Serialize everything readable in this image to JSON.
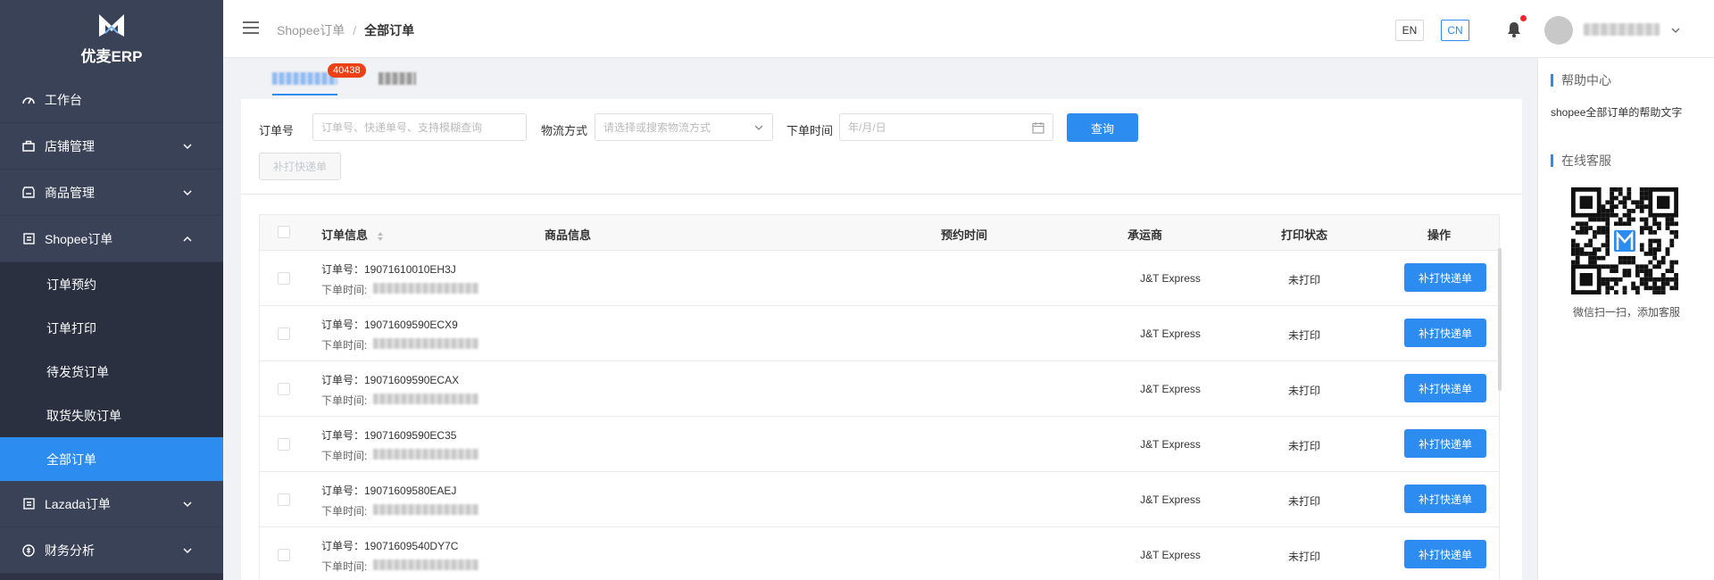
{
  "app": {
    "logo_text": "优麦ERP"
  },
  "sidebar": {
    "items": [
      {
        "label": "工作台",
        "icon": "dashboard-icon"
      },
      {
        "label": "店铺管理",
        "icon": "store-icon"
      },
      {
        "label": "商品管理",
        "icon": "goods-icon"
      },
      {
        "label": "Shopee订单",
        "icon": "order-icon"
      },
      {
        "label": "Lazada订单",
        "icon": "order-icon"
      },
      {
        "label": "财务分析",
        "icon": "finance-icon"
      }
    ],
    "shopee_sub": [
      {
        "label": "订单预约"
      },
      {
        "label": "订单打印"
      },
      {
        "label": "待发货订单"
      },
      {
        "label": "取货失败订单"
      },
      {
        "label": "全部订单"
      }
    ]
  },
  "header": {
    "breadcrumb": [
      "Shopee订单",
      "/",
      "全部订单"
    ],
    "lang_en": "EN",
    "lang_cn": "CN"
  },
  "tabs": {
    "badge": "40438"
  },
  "filter": {
    "order_label": "订单号",
    "order_placeholder": "订单号、快递单号、支持模糊查询",
    "logistics_label": "物流方式",
    "logistics_placeholder": "请选择或搜索物流方式",
    "time_label": "下单时间",
    "time_placeholder": "年/月/日",
    "query_label": "查询",
    "reprint_label": "补打快递单"
  },
  "table": {
    "headers": {
      "order_info": "订单信息",
      "product_info": "商品信息",
      "reserve_time": "预约时间",
      "carrier": "承运商",
      "print_status": "打印状态",
      "action": "操作"
    },
    "time_label": "下单时间:",
    "rows": [
      {
        "order_no": "订单号：19071610010EH3J",
        "carrier": "J&T Express",
        "status": "未打印",
        "action": "补打快递单"
      },
      {
        "order_no": "订单号：19071609590ECX9",
        "carrier": "J&T Express",
        "status": "未打印",
        "action": "补打快递单"
      },
      {
        "order_no": "订单号：19071609590ECAX",
        "carrier": "J&T Express",
        "status": "未打印",
        "action": "补打快递单"
      },
      {
        "order_no": "订单号：19071609590EC35",
        "carrier": "J&T Express",
        "status": "未打印",
        "action": "补打快递单"
      },
      {
        "order_no": "订单号：19071609580EAEJ",
        "carrier": "J&T Express",
        "status": "未打印",
        "action": "补打快递单"
      },
      {
        "order_no": "订单号：19071609540DY7C",
        "carrier": "J&T Express",
        "status": "未打印",
        "action": "补打快递单"
      }
    ]
  },
  "help": {
    "title": "帮助中心",
    "text": "shopee全部订单的帮助文字",
    "service_title": "在线客服",
    "qr_caption": "微信扫一扫，添加客服"
  },
  "colors": {
    "primary": "#2d8cf0",
    "sidebar_bg": "#2e3445",
    "badge": "#ed4014"
  }
}
